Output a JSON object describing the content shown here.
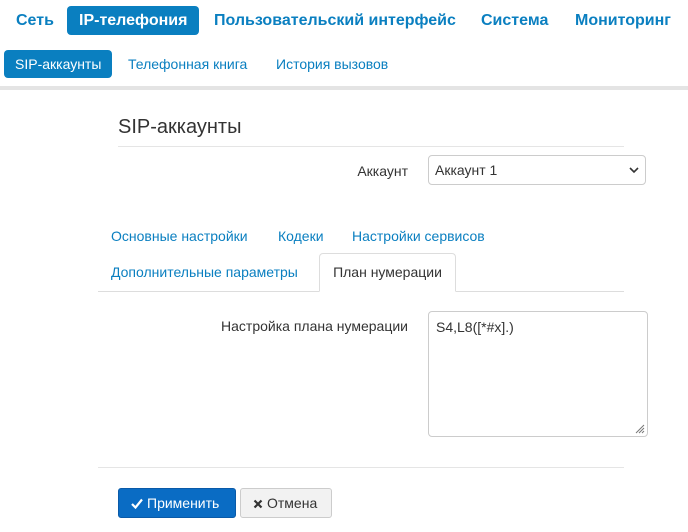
{
  "topnav": {
    "items": [
      {
        "label": "Сеть"
      },
      {
        "label": "IP-телефония",
        "active": true
      },
      {
        "label": "Пользовательский интерфейс"
      },
      {
        "label": "Система"
      },
      {
        "label": "Мониторинг"
      }
    ]
  },
  "subnav": {
    "items": [
      {
        "label": "SIP-аккаунты",
        "active": true
      },
      {
        "label": "Телефонная книга"
      },
      {
        "label": "История вызовов"
      }
    ]
  },
  "page": {
    "title": "SIP-аккаунты",
    "account_label": "Аккаунт",
    "account_value": "Аккаунт 1"
  },
  "tabs": [
    {
      "label": "Основные настройки"
    },
    {
      "label": "Кодеки"
    },
    {
      "label": "Настройки сервисов"
    },
    {
      "label": "Дополнительные параметры"
    },
    {
      "label": "План нумерации",
      "active": true
    }
  ],
  "dialplan": {
    "label": "Настройка плана нумерации",
    "value": "S4,L8([*#x].)"
  },
  "buttons": {
    "apply": "Применить",
    "cancel": "Отмена"
  },
  "colors": {
    "accent": "#0a7fc0",
    "primary_button": "#0a6cc4"
  }
}
